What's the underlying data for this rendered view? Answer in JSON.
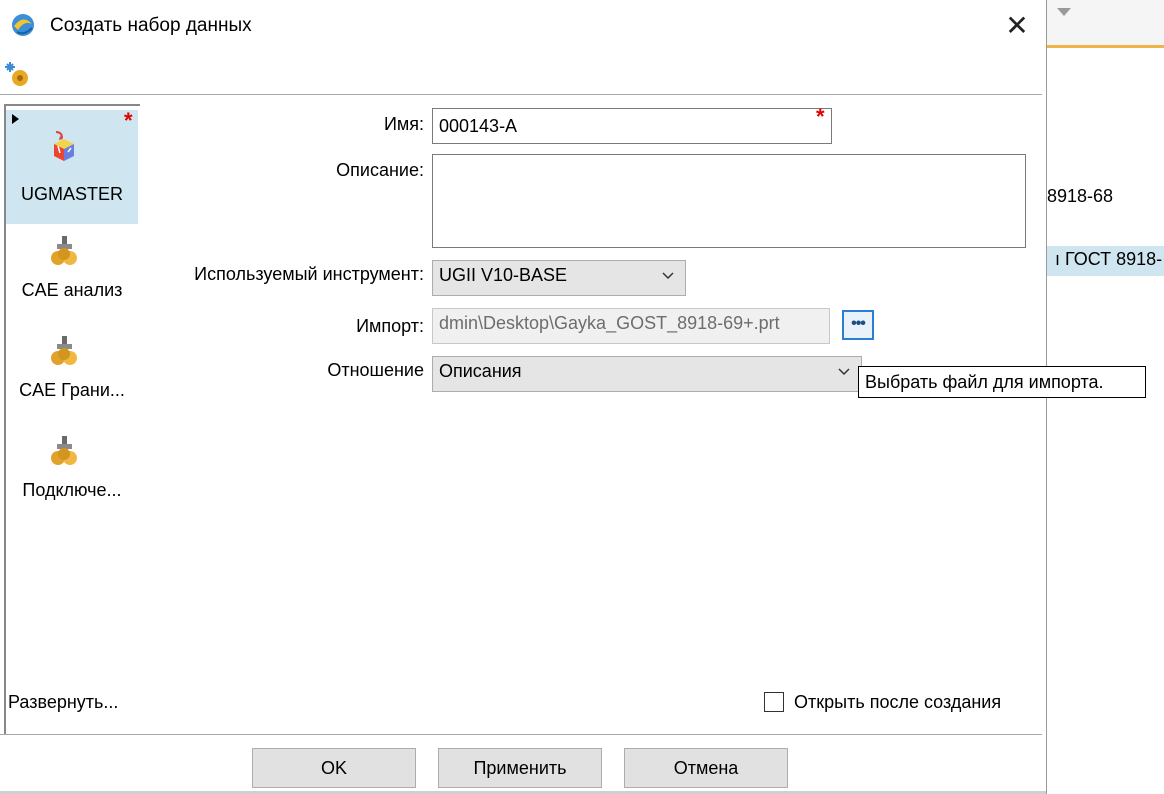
{
  "dialog": {
    "title": "Создать набор данных",
    "close_symbol": "✕"
  },
  "types": [
    {
      "label": "UGMASTER",
      "icon": "ugmaster-cube-icon",
      "selected": true
    },
    {
      "label": "CAE анализ",
      "icon": "cae-gear-icon",
      "selected": false
    },
    {
      "label": "CAE Грани...",
      "icon": "cae-gear-icon",
      "selected": false
    },
    {
      "label": "Подключе...",
      "icon": "cae-gear-icon",
      "selected": false
    }
  ],
  "expand_label": "Развернуть...",
  "form": {
    "name_label": "Имя:",
    "name_value": "000143-A",
    "description_label": "Описание:",
    "description_value": "",
    "tool_label": "Используемый инструмент:",
    "tool_value": "UGII V10-BASE",
    "import_label": "Импорт:",
    "import_value": "dmin\\Desktop\\Gayka_GOST_8918-69+.prt",
    "browse_symbol": "•••",
    "relation_label": "Отношение",
    "relation_value": "Описания",
    "required_symbol": "*"
  },
  "tooltip": "Выбрать файл для импорта.",
  "open_after_label": "Открыть после создания",
  "open_after_checked": false,
  "buttons": {
    "ok": "OK",
    "apply": "Применить",
    "cancel": "Отмена"
  },
  "background": {
    "line1": "8918-68",
    "line2": "ı ГОСТ 8918-"
  },
  "colors": {
    "selection": "#cfe6f0",
    "required": "#e00000",
    "accent": "#2b7fd0"
  }
}
